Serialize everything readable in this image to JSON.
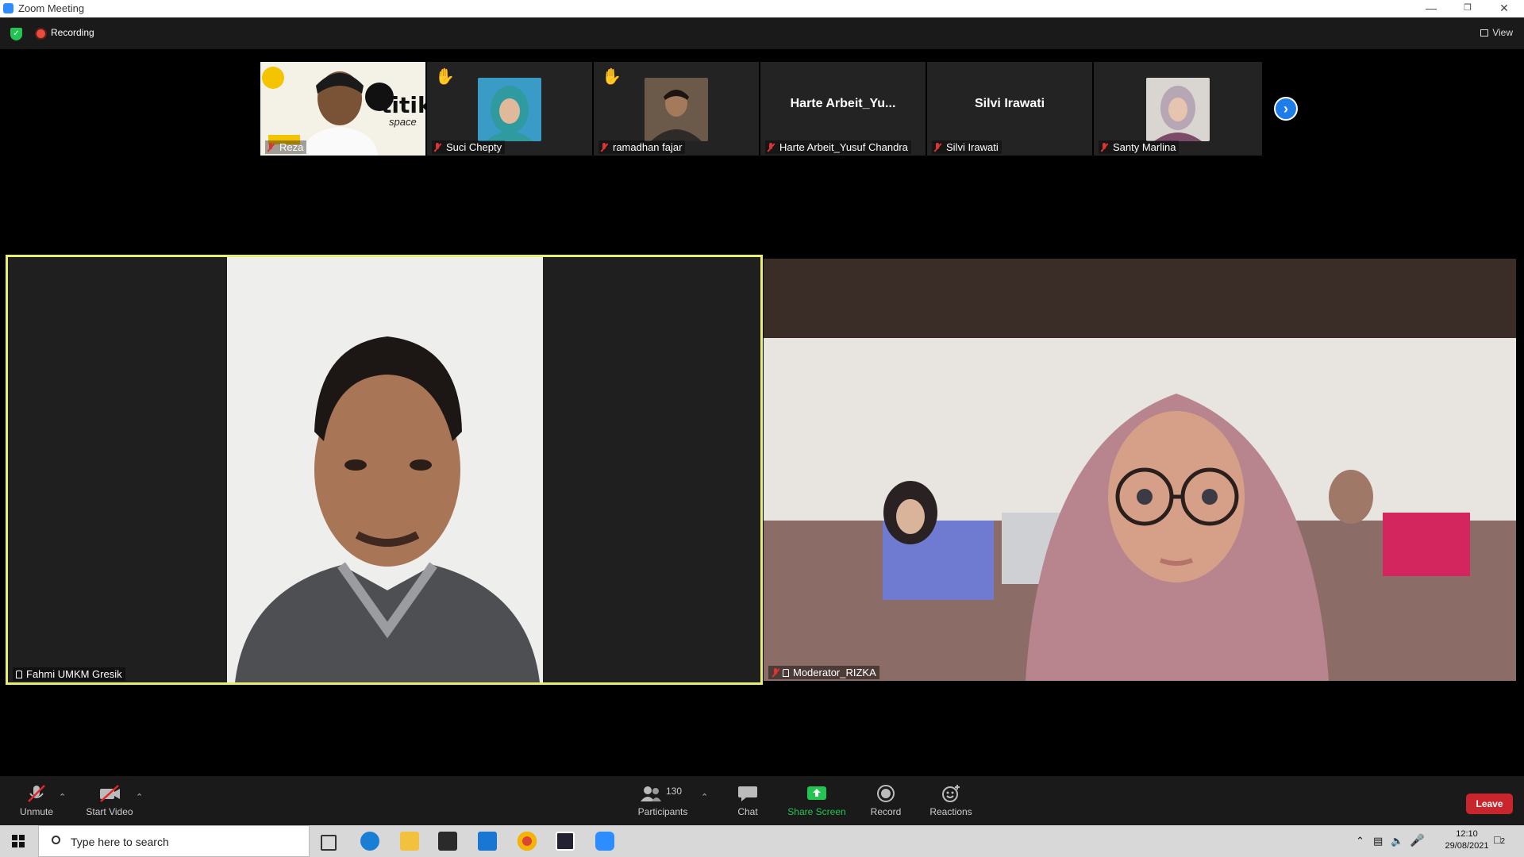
{
  "window": {
    "title": "Zoom Meeting"
  },
  "topbar": {
    "recording_label": "Recording",
    "view_label": "View"
  },
  "thumbnails": [
    {
      "name": "Reza",
      "hand_raised": true,
      "type": "video",
      "muted": true
    },
    {
      "name": "Suci Chepty",
      "hand_raised": true,
      "type": "avatar",
      "muted": true
    },
    {
      "name": "ramadhan fajar",
      "hand_raised": true,
      "type": "avatar",
      "muted": true
    },
    {
      "name": "Harte Arbeit_Yusuf Chandra",
      "display_name": "Harte  Arbeit_Yu...",
      "hand_raised": false,
      "type": "name",
      "muted": true
    },
    {
      "name": "Silvi Irawati",
      "display_name": "Silvi Irawati",
      "hand_raised": false,
      "type": "name",
      "muted": true
    },
    {
      "name": "Santy Marlina",
      "hand_raised": false,
      "type": "avatar",
      "muted": true
    }
  ],
  "reza_overlay_text": "titik",
  "reza_overlay_subtext": "space",
  "main_videos": {
    "left": {
      "name": "Fahmi UMKM Gresik",
      "active_speaker": true
    },
    "right": {
      "name": "Moderator_RIZKA"
    }
  },
  "toolbar": {
    "unmute": "Unmute",
    "start_video": "Start Video",
    "participants": "Participants",
    "participants_count": "130",
    "chat": "Chat",
    "share_screen": "Share Screen",
    "record": "Record",
    "reactions": "Reactions",
    "leave": "Leave"
  },
  "taskbar": {
    "search_placeholder": "Type here to search",
    "time": "12:10",
    "date": "29/08/2021",
    "notification_count": "2"
  },
  "colors": {
    "active_speaker_border": "#e8f06a",
    "share_screen_green": "#23c552",
    "leave_red": "#c8262c",
    "next_arrow_blue": "#1f7de8"
  }
}
